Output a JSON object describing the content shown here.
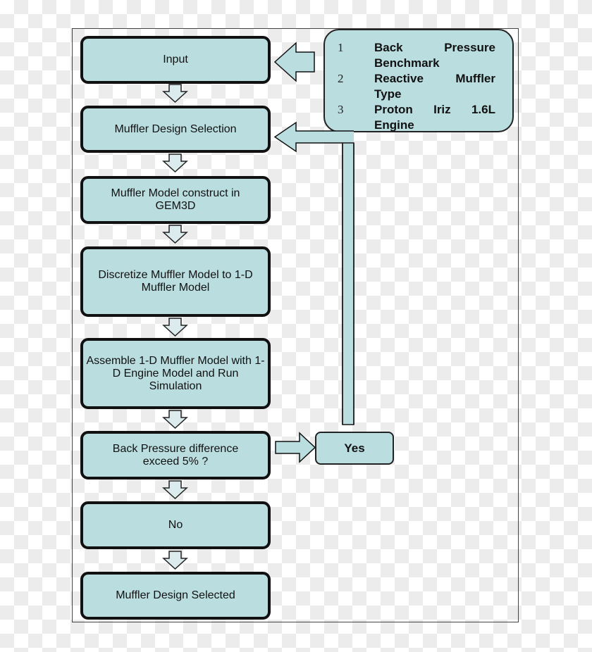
{
  "diagram": {
    "steps": [
      {
        "id": "input",
        "label": "Input"
      },
      {
        "id": "design-selection",
        "label": "Muffler Design Selection"
      },
      {
        "id": "model-construct",
        "label": "Muffler Model construct in GEM3D"
      },
      {
        "id": "discretize",
        "label": "Discretize Muffler Model to 1-D Muffler Model"
      },
      {
        "id": "assemble",
        "label": "Assemble 1-D Muffler Model with 1-D Engine Model and Run Simulation"
      },
      {
        "id": "decision",
        "label": "Back Pressure difference exceed 5% ?"
      },
      {
        "id": "no",
        "label": "No"
      },
      {
        "id": "selected",
        "label": "Muffler Design Selected"
      }
    ],
    "yes_label": "Yes",
    "inputs": [
      {
        "num": "1",
        "line1": "Back Pressure",
        "line2": "Benchmark"
      },
      {
        "num": "2",
        "line1": "Reactive Muffler",
        "line2": "Type"
      },
      {
        "num": "3",
        "line1": "Proton Iriz 1.6L",
        "line2": "Engine"
      }
    ],
    "colors": {
      "box_fill": "#badde0",
      "arrow_fill": "#dcecee",
      "border": "#111111"
    }
  }
}
